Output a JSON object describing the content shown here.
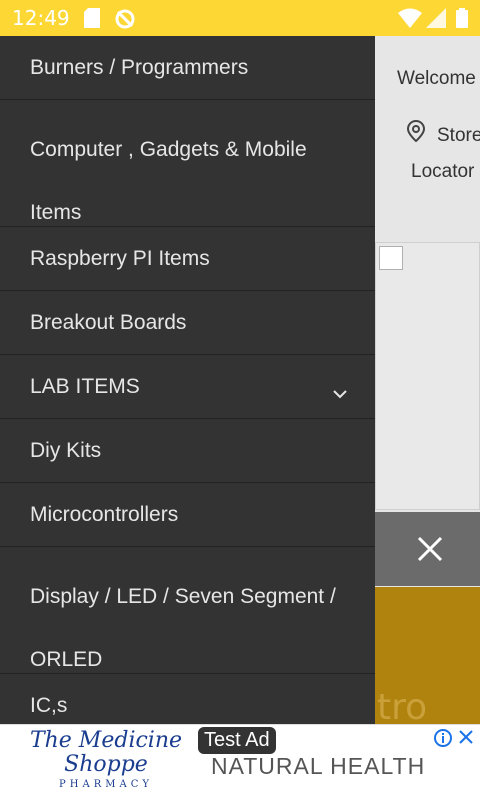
{
  "status_bar": {
    "time": "12:49"
  },
  "background": {
    "welcome_text": "Welcome",
    "store_line1": "Store",
    "store_line2": "Locator",
    "bottom_text": "tro"
  },
  "drawer": {
    "items": [
      {
        "label": "Burners / Programmers"
      },
      {
        "label": "Computer , Gadgets & Mobile Items"
      },
      {
        "label": "Raspberry PI Items"
      },
      {
        "label": "Breakout Boards"
      },
      {
        "label": "LAB ITEMS"
      },
      {
        "label": "Diy Kits"
      },
      {
        "label": "Microcontrollers"
      },
      {
        "label": "Display / LED / Seven Segment / ORLED"
      },
      {
        "label": "IC,s"
      }
    ]
  },
  "ad": {
    "badge": "Test Ad",
    "logo_line1": "The Medicine",
    "logo_line2": "Shoppe",
    "logo_line3": "PHARMACY",
    "brand": "NATURAL HEALTH"
  },
  "colors": {
    "status_bar": "#fdd835",
    "drawer_bg": "#333333",
    "accent_gold": "#b0820e"
  }
}
